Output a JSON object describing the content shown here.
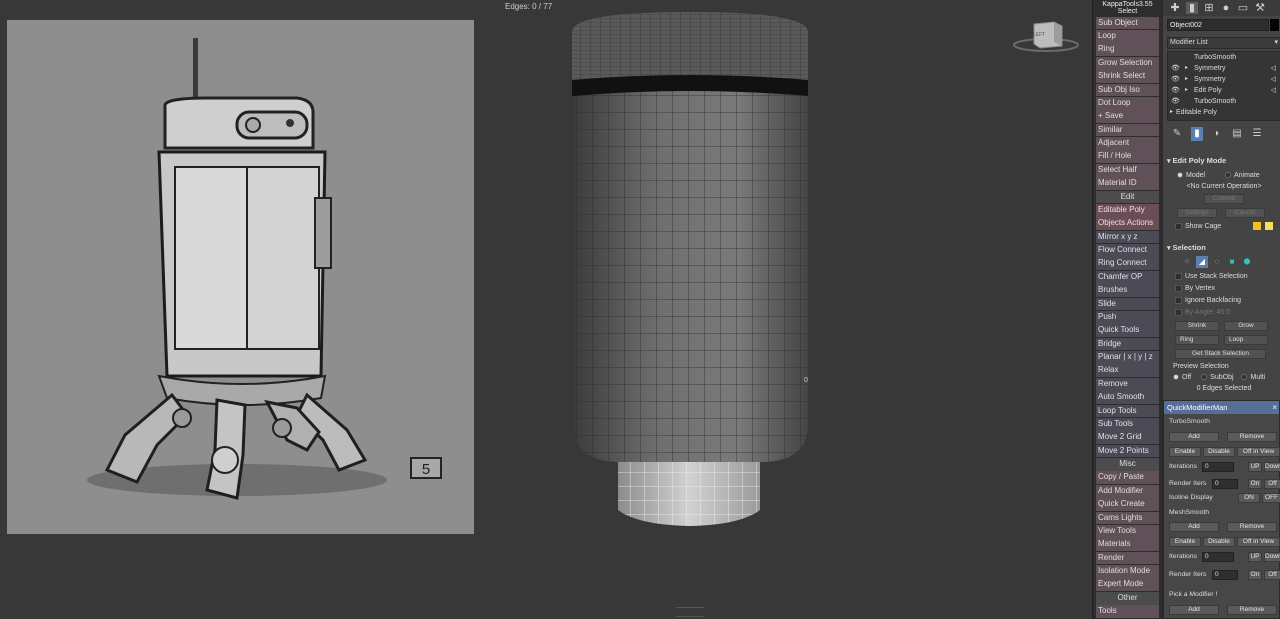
{
  "viewport": {
    "label": "Edges: 0 / 77",
    "viewcube_label": "LEFT",
    "edge_marker": "0"
  },
  "reference_image": {
    "sticker_text": "5"
  },
  "kappa": {
    "title_line1": "KappaTools3.55",
    "title_line2": "Select",
    "buttons": [
      {
        "label": "Sub Object",
        "style": "normal"
      },
      {
        "label": "Loop",
        "style": "normal"
      },
      {
        "label": "Ring",
        "style": "normal"
      },
      {
        "label": "Grow Selection",
        "style": "normal"
      },
      {
        "label": "Shrink Select",
        "style": "normal"
      },
      {
        "label": "Sub Obj Iso",
        "style": "normal"
      },
      {
        "label": "Dot Loop",
        "style": "normal"
      },
      {
        "label": "+ Save",
        "style": "normal"
      },
      {
        "label": "Similar",
        "style": "normal"
      },
      {
        "label": "Adjacent",
        "style": "normal"
      },
      {
        "label": "Fill / Hole",
        "style": "normal"
      },
      {
        "label": "Select Half",
        "style": "normal"
      },
      {
        "label": "Material ID",
        "style": "normal"
      },
      {
        "label": "Edit",
        "style": "section"
      },
      {
        "label": "Editable Poly",
        "style": "selected"
      },
      {
        "label": "Objects Actions",
        "style": "selected"
      },
      {
        "label": "Mirror   x  y  z",
        "style": "alt"
      },
      {
        "label": "Flow Connect",
        "style": "alt"
      },
      {
        "label": "Ring Connect",
        "style": "alt"
      },
      {
        "label": "Chamfer OP",
        "style": "alt"
      },
      {
        "label": "Brushes",
        "style": "alt"
      },
      {
        "label": "Slide",
        "style": "alt"
      },
      {
        "label": "Push",
        "style": "alt"
      },
      {
        "label": "Quick Tools",
        "style": "alt"
      },
      {
        "label": "Bridge",
        "style": "alt"
      },
      {
        "label": "Planar | x | y | z",
        "style": "alt"
      },
      {
        "label": "Relax",
        "style": "alt"
      },
      {
        "label": "Remove",
        "style": "alt"
      },
      {
        "label": "Auto Smooth",
        "style": "alt"
      },
      {
        "label": "Loop Tools",
        "style": "alt"
      },
      {
        "label": "Sub Tools",
        "style": "alt"
      },
      {
        "label": "Move 2 Grid",
        "style": "alt"
      },
      {
        "label": "Move 2 Points",
        "style": "alt"
      },
      {
        "label": "Misc",
        "style": "section"
      },
      {
        "label": "Copy / Paste",
        "style": "normal"
      },
      {
        "label": "Add Modifier",
        "style": "normal"
      },
      {
        "label": "Quick Create",
        "style": "normal"
      },
      {
        "label": "Cams Lights",
        "style": "normal"
      },
      {
        "label": "View Tools",
        "style": "normal"
      },
      {
        "label": "Materials",
        "style": "normal"
      },
      {
        "label": "Render",
        "style": "normal"
      },
      {
        "label": "Isolation Mode",
        "style": "normal"
      },
      {
        "label": "Expert Mode",
        "style": "normal"
      },
      {
        "label": "Other",
        "style": "section"
      },
      {
        "label": "Tools",
        "style": "normal"
      }
    ]
  },
  "command_panel": {
    "object_name": "Object002",
    "modifier_list": "Modifier List",
    "stack": [
      {
        "label": "TurboSmooth",
        "eye": false,
        "arrow": false,
        "tri": false
      },
      {
        "label": "Symmetry",
        "eye": true,
        "arrow": true,
        "tri": true
      },
      {
        "label": "Symmetry",
        "eye": true,
        "arrow": true,
        "tri": true
      },
      {
        "label": "Edit Poly",
        "eye": true,
        "arrow": true,
        "tri": true
      },
      {
        "label": "TurboSmooth",
        "eye": true,
        "arrow": false,
        "tri": false
      },
      {
        "label": "Editable Poly",
        "eye": false,
        "arrow": true,
        "tri": false,
        "base": true
      }
    ],
    "edit_poly": {
      "title": "Edit Poly Mode",
      "model": "Model",
      "animate": "Animate",
      "operation": "<No Current Operation>",
      "commit": "Commit",
      "settings": "Settings",
      "cancel": "Cancel",
      "show_cage": "Show Cage",
      "cage_color_1": "#f0c020",
      "cage_color_2": "#f0e060"
    },
    "selection": {
      "title": "Selection",
      "use_stack": "Use Stack Selection",
      "by_vertex": "By Vertex",
      "ignore_backfacing": "Ignore Backfacing",
      "by_angle": "By Angle:",
      "angle_value": "45.0",
      "shrink": "Shrink",
      "grow": "Grow",
      "ring": "Ring",
      "loop": "Loop",
      "get_stack": "Get Stack Selection",
      "preview": "Preview Selection",
      "off": "Off",
      "subobj": "SubObj",
      "multi": "Multi",
      "status": "0 Edges Selected"
    }
  },
  "qmm": {
    "title": "QuickModifierMan",
    "close": "×",
    "turbo": {
      "name": "TurboSmooth",
      "add": "Add",
      "remove": "Remove",
      "enable": "Enable",
      "disable": "Disable",
      "off_in_view": "Off in View",
      "iterations": "Iterations",
      "iter_value": "0",
      "up": "UP",
      "down": "Down",
      "render_iters": "Render Iters",
      "render_value": "0",
      "on": "On",
      "off": "Off",
      "isoline": "Isoline Display",
      "iso_on": "ON",
      "iso_off": "OFF"
    },
    "mesh": {
      "name": "MeshSmooth",
      "add": "Add",
      "remove": "Remove",
      "enable": "Enable",
      "disable": "Disable",
      "off_in_view": "Off in View",
      "iterations": "Iterations",
      "iter_value": "0",
      "up": "UP",
      "down": "Down",
      "render_iters": "Render Iters",
      "render_value": "0",
      "on": "On",
      "off": "Off"
    },
    "pick": "Pick a Modifier !",
    "pick_add": "Add",
    "pick_remove": "Remove"
  }
}
